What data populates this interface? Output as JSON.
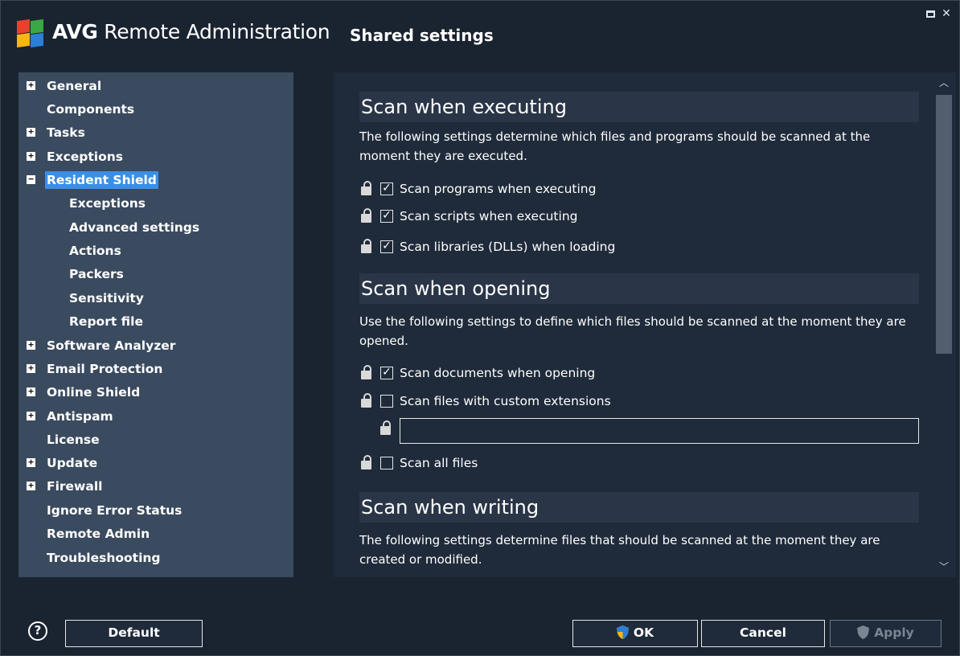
{
  "titlebar": {
    "brand": "AVG",
    "app_name": "Remote Administration",
    "page_title": "Shared settings"
  },
  "tree": {
    "items": [
      {
        "label": "General",
        "expander": "+"
      },
      {
        "label": "Components",
        "expander": ""
      },
      {
        "label": "Tasks",
        "expander": "+"
      },
      {
        "label": "Exceptions",
        "expander": "+"
      },
      {
        "label": "Resident Shield",
        "expander": "−",
        "selected": true
      },
      {
        "label": "Exceptions",
        "expander": ""
      },
      {
        "label": "Advanced settings",
        "expander": ""
      },
      {
        "label": "Actions",
        "expander": ""
      },
      {
        "label": "Packers",
        "expander": ""
      },
      {
        "label": "Sensitivity",
        "expander": ""
      },
      {
        "label": "Report file",
        "expander": ""
      },
      {
        "label": "Software Analyzer",
        "expander": "+"
      },
      {
        "label": "Email Protection",
        "expander": "+"
      },
      {
        "label": "Online Shield",
        "expander": "+"
      },
      {
        "label": "Antispam",
        "expander": "+"
      },
      {
        "label": "License",
        "expander": ""
      },
      {
        "label": "Update",
        "expander": "+"
      },
      {
        "label": "Firewall",
        "expander": "+"
      },
      {
        "label": "Ignore Error Status",
        "expander": ""
      },
      {
        "label": "Remote Admin",
        "expander": ""
      },
      {
        "label": "Troubleshooting",
        "expander": ""
      }
    ]
  },
  "content": {
    "sections": [
      {
        "heading": "Scan when executing",
        "description": "The following settings determine which files and programs should be scanned at the moment they are executed.",
        "options": [
          {
            "label": "Scan programs when executing",
            "checked": true
          },
          {
            "label": "Scan scripts when executing",
            "checked": true
          },
          {
            "label": "Scan libraries (DLLs) when loading",
            "checked": true
          }
        ]
      },
      {
        "heading": "Scan when opening",
        "description": "Use the following settings to define which files should be scanned at the moment they are opened.",
        "options": [
          {
            "label": "Scan documents when opening",
            "checked": true
          },
          {
            "label": "Scan files with custom extensions",
            "checked": false
          },
          {
            "label": "Scan all files",
            "checked": false
          }
        ],
        "extensions_value": ""
      },
      {
        "heading": "Scan when writing",
        "description": "The following settings determine files that should be scanned at the moment they are created or modified."
      }
    ]
  },
  "footer": {
    "help_glyph": "?",
    "default_label": "Default",
    "ok_label": "OK",
    "cancel_label": "Cancel",
    "apply_label": "Apply"
  },
  "colors": {
    "background": "#1a2330",
    "tree_bg": "#3a4a5f",
    "selected": "#3b8ee6",
    "content_bg": "#1f2b3a"
  }
}
